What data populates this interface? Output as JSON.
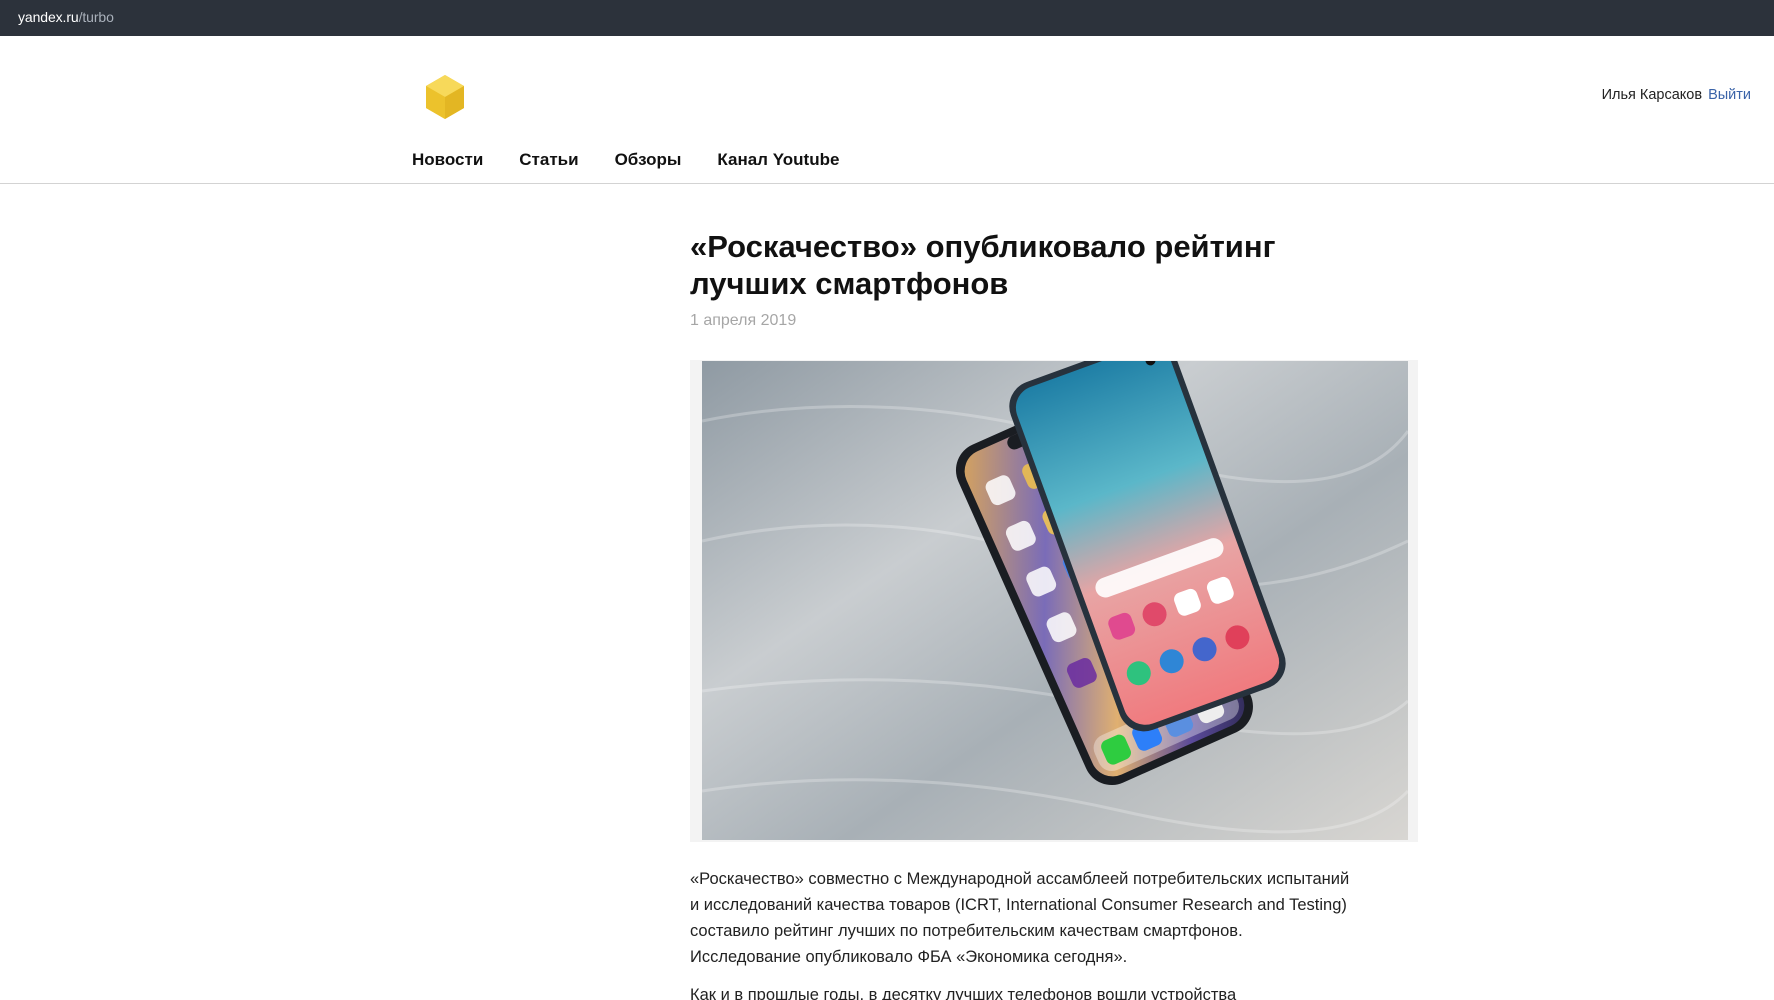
{
  "browser": {
    "url_host": "yandex.ru",
    "url_path": "/turbo"
  },
  "header": {
    "logo_icon": "yellow-hexagon-logo",
    "user_name": "Илья Карсаков",
    "logout_label": "Выйти"
  },
  "nav": {
    "items": [
      {
        "label": "Новости"
      },
      {
        "label": "Статьи"
      },
      {
        "label": "Обзоры"
      },
      {
        "label": "Канал Youtube"
      }
    ]
  },
  "article": {
    "title": "«Роскачество» опубликовало рейтинг лучших смартфонов",
    "date": "1 апреля 2019",
    "image_alt": "iPhone XS Max and Samsung Galaxy S10 on a wooden surface",
    "paragraphs": [
      "«Роскачество» совместно с Международной ассамблеей потребительских испытаний и исследований качества товаров (ICRT, International Consumer Research and Testing) составило рейтинг лучших по потребительским качествам смартфонов. Исследование опубликовало ФБА «Экономика сегодня».",
      "Как и в прошлые годы, в десятку лучших телефонов вошли устройства"
    ]
  },
  "colors": {
    "topbar": "#2c323b",
    "logo_yellow": "#f2c933",
    "link_blue": "#3a63a8"
  }
}
